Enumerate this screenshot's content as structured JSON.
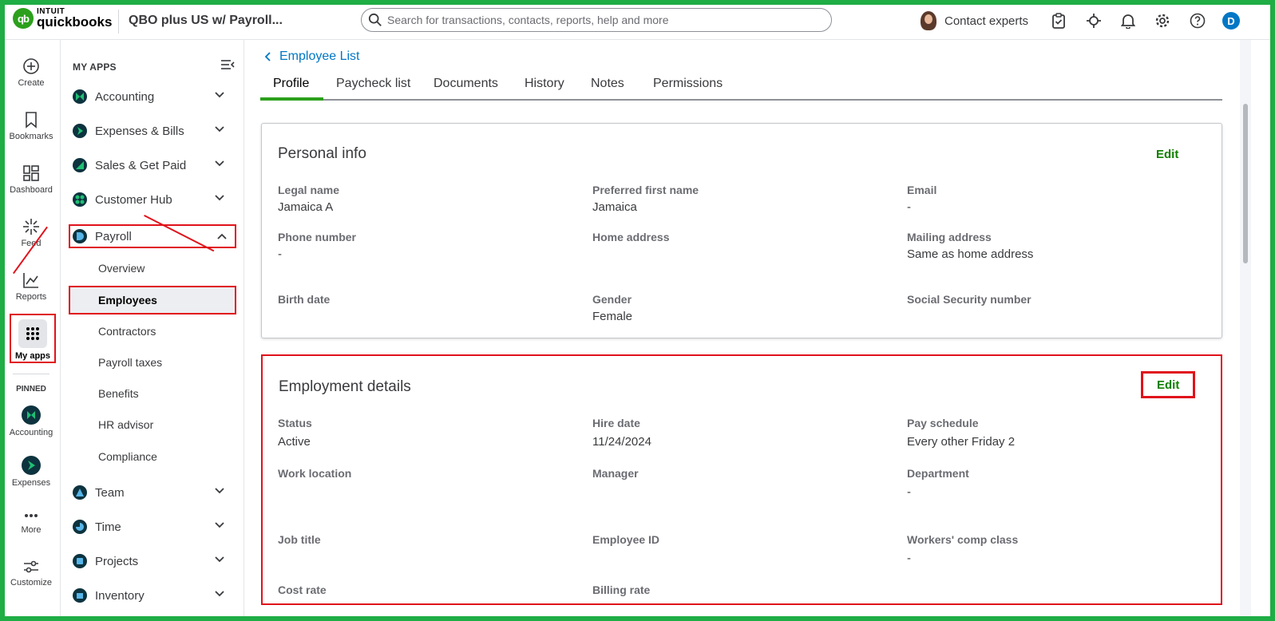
{
  "brand": {
    "intuit": "INTUIT",
    "name": "quickbooks",
    "mark": "qb"
  },
  "company": "QBO plus US w/ Payroll...",
  "search": {
    "placeholder": "Search for transactions, contacts, reports, help and more"
  },
  "contact_experts": "Contact experts",
  "user_initial": "D",
  "rail": {
    "create": "Create",
    "bookmarks": "Bookmarks",
    "dashboard": "Dashboard",
    "feed": "Feed",
    "reports": "Reports",
    "my_apps": "My apps",
    "pinned": "PINNED",
    "accounting": "Accounting",
    "expenses": "Expenses",
    "more": "More",
    "customize": "Customize"
  },
  "panel": {
    "title": "MY APPS",
    "apps": [
      {
        "label": "Accounting"
      },
      {
        "label": "Expenses & Bills"
      },
      {
        "label": "Sales & Get Paid"
      },
      {
        "label": "Customer Hub"
      },
      {
        "label": "Payroll"
      },
      {
        "label": "Team"
      },
      {
        "label": "Time"
      },
      {
        "label": "Projects"
      },
      {
        "label": "Inventory"
      }
    ],
    "payroll_sub": [
      "Overview",
      "Employees",
      "Contractors",
      "Payroll taxes",
      "Benefits",
      "HR advisor",
      "Compliance"
    ]
  },
  "main": {
    "back_label": "Employee List",
    "tabs": [
      "Profile",
      "Paycheck list",
      "Documents",
      "History",
      "Notes",
      "Permissions"
    ],
    "personal": {
      "title": "Personal info",
      "edit": "Edit",
      "fields": [
        {
          "label": "Legal name",
          "value": "Jamaica A"
        },
        {
          "label": "Preferred first name",
          "value": "Jamaica"
        },
        {
          "label": "Email",
          "value": "-"
        },
        {
          "label": "Phone number",
          "value": "-"
        },
        {
          "label": "Home address",
          "value": ""
        },
        {
          "label": "Mailing address",
          "value": "Same as home address"
        },
        {
          "label": "Birth date",
          "value": ""
        },
        {
          "label": "Gender",
          "value": "Female"
        },
        {
          "label": "Social Security number",
          "value": ""
        }
      ]
    },
    "employment": {
      "title": "Employment details",
      "edit": "Edit",
      "fields": [
        {
          "label": "Status",
          "value": "Active"
        },
        {
          "label": "Hire date",
          "value": "11/24/2024"
        },
        {
          "label": "Pay schedule",
          "value": "Every other Friday 2"
        },
        {
          "label": "Work location",
          "value": ""
        },
        {
          "label": "Manager",
          "value": ""
        },
        {
          "label": "Department",
          "value": "-"
        },
        {
          "label": "Job title",
          "value": ""
        },
        {
          "label": "Employee ID",
          "value": ""
        },
        {
          "label": "Workers' comp class",
          "value": "-"
        },
        {
          "label": "Cost rate",
          "value": ""
        },
        {
          "label": "Billing rate",
          "value": ""
        }
      ]
    }
  },
  "colors": {
    "brand_green": "#2ca01c",
    "frame_green": "#1fad45",
    "annotation_red": "#e0121b",
    "link_blue": "#0077c5",
    "edit_green": "#108000",
    "app_dark": "#0d333f"
  }
}
